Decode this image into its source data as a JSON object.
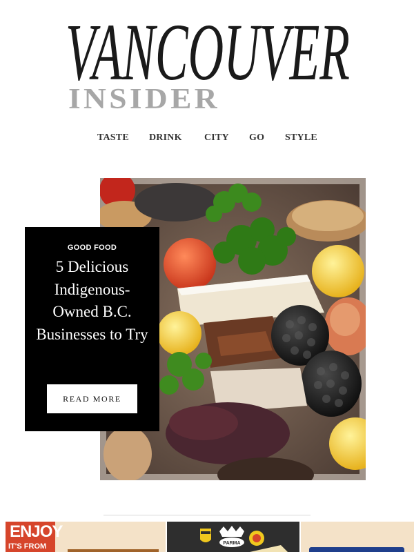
{
  "masthead": {
    "logo_line1": "VANCOUVER",
    "logo_line2": "INSIDER"
  },
  "nav": {
    "items": [
      {
        "label": "TASTE"
      },
      {
        "label": "DRINK"
      },
      {
        "label": "CITY"
      },
      {
        "label": "GO"
      },
      {
        "label": "STYLE"
      }
    ]
  },
  "feature": {
    "kicker": "GOOD FOOD",
    "headline": "5 Delicious Indigenous-Owned B.C. Businesses to Try",
    "cta_label": "READ MORE"
  },
  "ad": {
    "enjoy": "ENJOY",
    "tagline": "IT'S FROM",
    "logos": [
      "PARMA"
    ]
  },
  "colors": {
    "card_background": "#000000",
    "logo_black": "#1a1a1a",
    "logo_grey": "#a7a7a7",
    "nav_text": "#333333",
    "divider": "#d6d6d6",
    "ad_red": "#d6452b",
    "ad_blue": "#1f3f8c"
  }
}
